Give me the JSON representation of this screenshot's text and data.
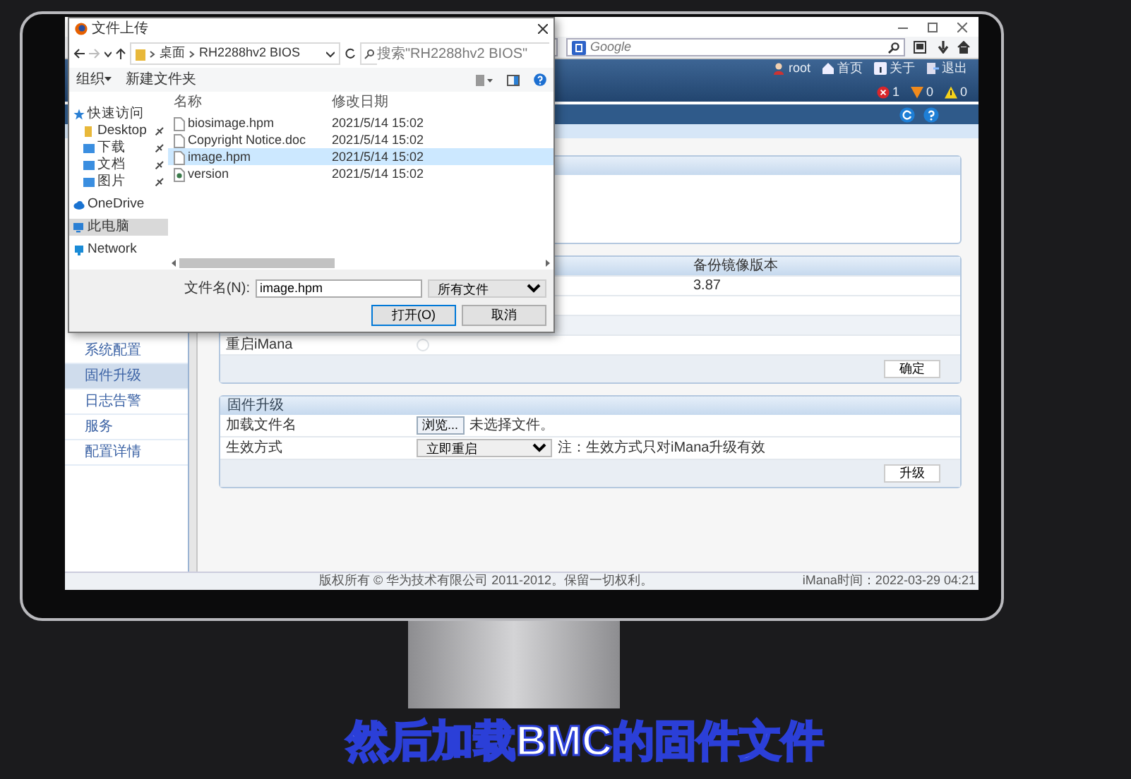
{
  "browser": {
    "search": {
      "placeholder": "Google"
    }
  },
  "app_header": {
    "user_links": [
      {
        "kind": "user",
        "label": "root"
      },
      {
        "kind": "home",
        "label": "首页"
      },
      {
        "kind": "info",
        "label": "关于"
      },
      {
        "kind": "logout",
        "label": "退出"
      }
    ],
    "alerts": [
      {
        "kind": "critical",
        "count": "1"
      },
      {
        "kind": "major",
        "count": "0"
      },
      {
        "kind": "minor",
        "count": "0"
      }
    ]
  },
  "sidebar": {
    "items": [
      {
        "label": "系统配置",
        "selected": false
      },
      {
        "label": "固件升级",
        "selected": true
      },
      {
        "label": "日志告警",
        "selected": false
      },
      {
        "label": "服务",
        "selected": false
      },
      {
        "label": "配置详情",
        "selected": false
      }
    ]
  },
  "backup_panel": {
    "column_3": "备份镜像版本",
    "backup_version": "3.87",
    "restart_option": {
      "label": "重启iMana",
      "checked": false
    },
    "button": "确定"
  },
  "upgrade_panel": {
    "title": "固件升级",
    "file_row": {
      "label": "加载文件名",
      "button": "浏览...",
      "status": "未选择文件。"
    },
    "mode_row": {
      "label": "生效方式",
      "value": "立即重启",
      "note": "注：生效方式只对iMana升级有效"
    },
    "button": "升级"
  },
  "footer": {
    "copyright": "版权所有 © 华为技术有限公司 2011-2012。保留一切权利。",
    "time_label": "iMana时间：",
    "time": "2022-03-29 04:21"
  },
  "dialog": {
    "title": "文件上传",
    "breadcrumb": [
      "桌面",
      "RH2288hv2 BIOS"
    ],
    "search": {
      "placeholder": "搜索\"RH2288hv2 BIOS\""
    },
    "toolbar": [
      "组织",
      "新建文件夹"
    ],
    "nav_tree": [
      {
        "kind": "star",
        "label": "快速访问",
        "selected": false,
        "children": [
          {
            "kind": "yellow-folder",
            "label": "Desktop",
            "selected": false,
            "pinned": true
          },
          {
            "kind": "blue-folder",
            "label": "下载",
            "selected": false,
            "pinned": true
          },
          {
            "kind": "blue-folder",
            "label": "文档",
            "selected": false,
            "pinned": true
          },
          {
            "kind": "blue-folder",
            "label": "图片",
            "selected": false,
            "pinned": true
          }
        ]
      },
      {
        "kind": "cloud",
        "label": "OneDrive",
        "selected": false
      },
      {
        "kind": "pc",
        "label": "此电脑",
        "selected": true
      },
      {
        "kind": "network",
        "label": "Network",
        "selected": false
      }
    ],
    "columns": [
      "名称",
      "修改日期"
    ],
    "files": [
      {
        "kind": "file",
        "name": "biosimage.hpm",
        "date": "2021/5/14 15:02",
        "selected": false
      },
      {
        "kind": "file",
        "name": "Copyright Notice.doc",
        "date": "2021/5/14 15:02",
        "selected": false
      },
      {
        "kind": "file",
        "name": "image.hpm",
        "date": "2021/5/14 15:02",
        "selected": true
      },
      {
        "kind": "setup",
        "name": "version",
        "date": "2021/5/14 15:02",
        "selected": false
      }
    ],
    "filename": {
      "label": "文件名(N):",
      "value": "image.hpm"
    },
    "filter": "所有文件",
    "buttons": [
      {
        "label": "打开(O)",
        "default": true
      },
      {
        "label": "取消",
        "default": false
      }
    ]
  },
  "subtitle": "然后加载BMC的固件文件"
}
